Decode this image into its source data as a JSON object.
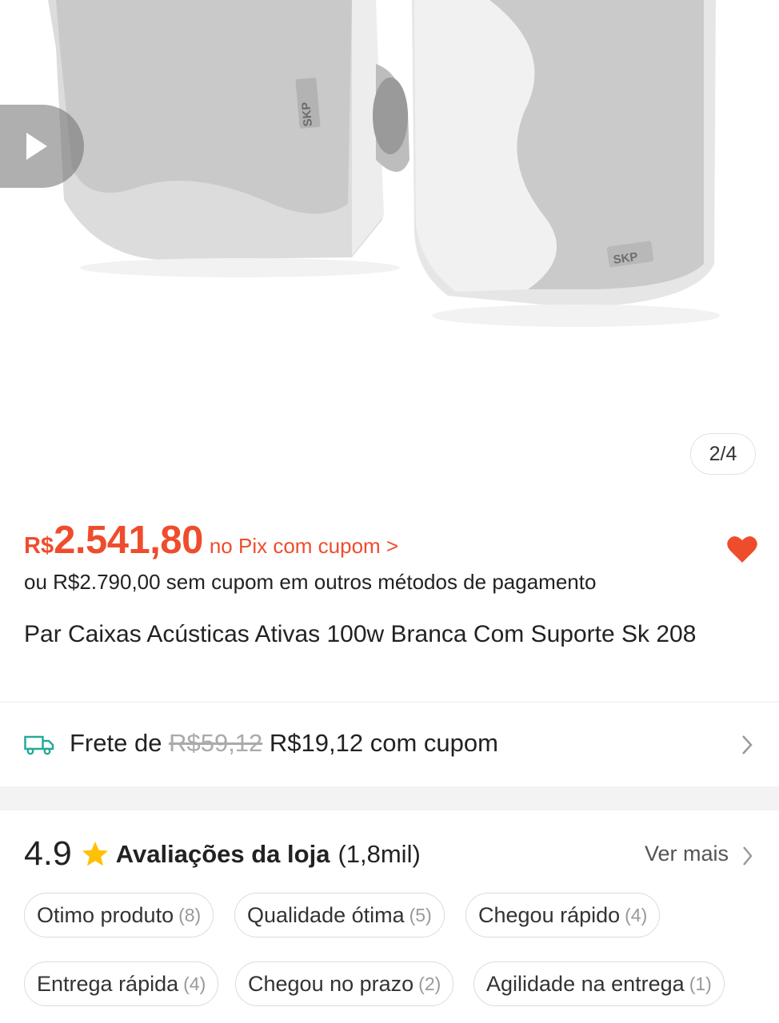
{
  "gallery": {
    "counter": "2/4",
    "brand_mark": "SKP",
    "image_alt": "Par Caixas Acústicas Ativas 100w Branca Com Suporte Sk 208"
  },
  "price": {
    "currency": "R$",
    "value": "2.541,80",
    "note": "no Pix com cupom >",
    "alternative": "ou R$2.790,00 sem cupom em outros métodos de pagamento"
  },
  "product": {
    "title": "Par Caixas Acústicas Ativas 100w Branca Com Suporte Sk 208"
  },
  "shipping": {
    "prefix": "Frete de",
    "old_price": "R$59,12",
    "new_price": "R$19,12 com cupom"
  },
  "reviews": {
    "rating": "4.9",
    "title": "Avaliações da loja",
    "count": "(1,8mil)",
    "see_more": "Ver mais",
    "tags": [
      {
        "label": "Otimo produto",
        "count": "(8)"
      },
      {
        "label": "Qualidade ótima",
        "count": "(5)"
      },
      {
        "label": "Chegou rápido",
        "count": "(4)"
      },
      {
        "label": "Entrega rápida",
        "count": "(4)"
      },
      {
        "label": "Chegou no prazo",
        "count": "(2)"
      },
      {
        "label": "Agilidade na entrega",
        "count": "(1)"
      }
    ]
  },
  "colors": {
    "accent": "#ee4d2d",
    "truck": "#26aa99",
    "star": "#ffc107"
  },
  "icons": {
    "play": "play-icon",
    "heart": "heart-icon",
    "truck": "truck-icon",
    "star": "star-icon",
    "chevron": "chevron-right-icon"
  }
}
